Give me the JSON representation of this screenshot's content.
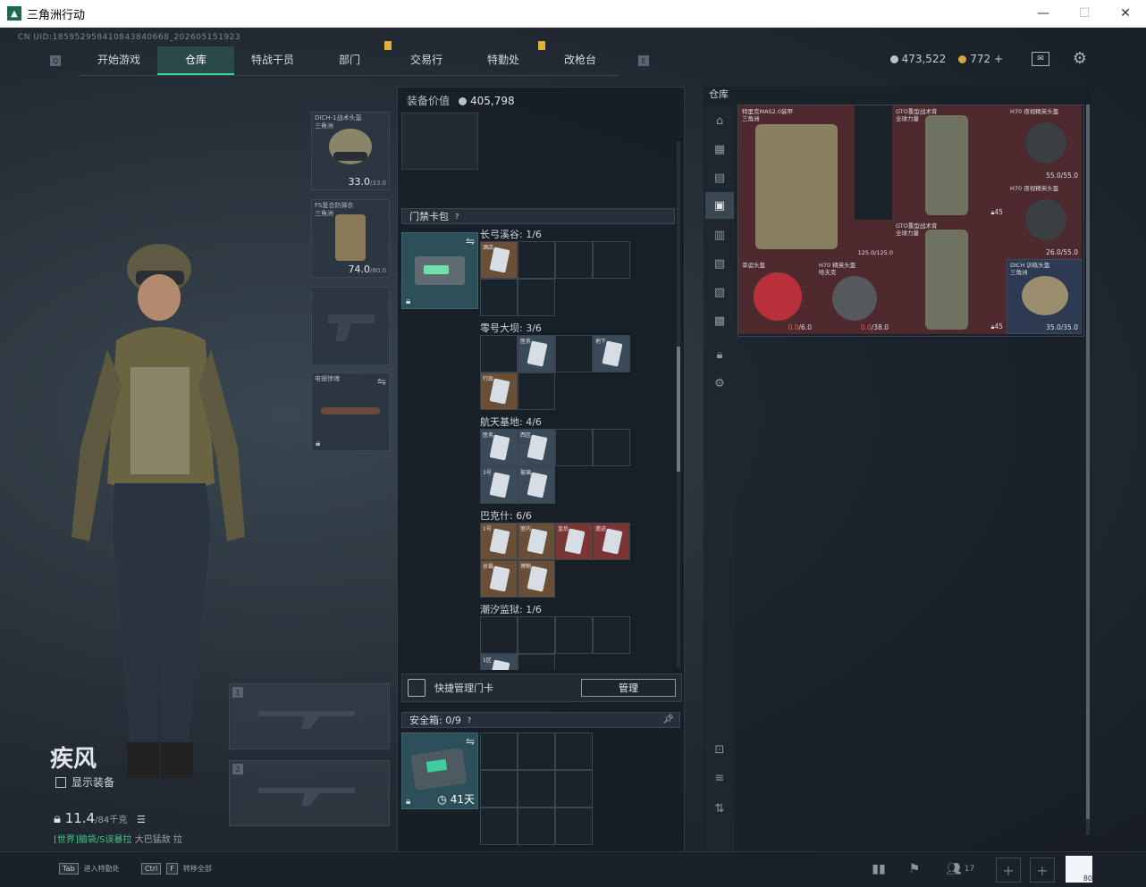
{
  "window": {
    "title": "三角洲行动",
    "minimize": "—",
    "maximize": "☐",
    "close": "✕"
  },
  "uid": "CN UID:1859529584108438406​68_202605151923",
  "nav": {
    "left_key": "Q",
    "right_key": "E",
    "tabs": [
      {
        "label": "开始游戏",
        "active": false,
        "badge": false
      },
      {
        "label": "仓库",
        "active": true,
        "badge": false
      },
      {
        "label": "特战干员",
        "active": false,
        "badge": false
      },
      {
        "label": "部门",
        "active": false,
        "badge": true
      },
      {
        "label": "交易行",
        "active": false,
        "badge": false
      },
      {
        "label": "特勤处",
        "active": false,
        "badge": true
      },
      {
        "label": "改枪台",
        "active": false,
        "badge": false
      }
    ]
  },
  "currency": {
    "silver": "473,522",
    "gold": "772",
    "gold_plus": "+"
  },
  "character": {
    "name": "疾风",
    "show_equipment": "显示装备",
    "weight": "11.4",
    "weight_max": "/84千克",
    "status_green": "[世界]脑袋/S误暴拉",
    "status_rest": " 大巴猛敌 拉"
  },
  "gear": {
    "helmet": {
      "label1": "DICH-1战术头盔",
      "label2": "三角洲",
      "dur": "33.0",
      "dur_max": "/33.0"
    },
    "armor": {
      "label1": "FS复合防弹衣",
      "label2": "三角洲",
      "dur": "74.0",
      "dur_max": "/80.0"
    },
    "melee": {
      "label1": "电锯惊魂"
    },
    "weapon1": "1",
    "weapon2": "2"
  },
  "mid": {
    "equip_value_label": "装备价值",
    "equip_value": "405,798",
    "keybag_label": "门禁卡包",
    "keybag_help": "?",
    "groups": [
      {
        "title": "长弓溪谷: 1/6",
        "card_labels": [
          "酒店"
        ]
      },
      {
        "title": "零号大坝: 3/6",
        "card_labels": [
          "医务",
          "地下",
          "行政"
        ]
      },
      {
        "title": "航天基地: 4/6",
        "card_labels": [
          "医务",
          "西区",
          "3号",
          "玻璃"
        ]
      },
      {
        "title": "巴克什: 6/6",
        "card_labels": [
          "1号",
          "室内",
          "皇后",
          "遗迹",
          "总裁",
          "博物"
        ]
      },
      {
        "title": "潮汐监狱: 1/6",
        "card_labels": [
          "1区"
        ]
      }
    ],
    "quick_manage": "快捷管理门卡",
    "manage_btn": "管理",
    "safe_label": "安全箱:",
    "safe_count": "0/9",
    "safe_help": "?",
    "safe_days": "41天"
  },
  "right": {
    "title": "仓库",
    "items": [
      {
        "name1": "特里克MAS2.0装甲",
        "name2": "三角洲",
        "dur": ""
      },
      {
        "name1": "GTO重型战术背",
        "name2": "全球力量",
        "dur": "45"
      },
      {
        "name1": "H70 夜视精英头盔",
        "name2": "",
        "dur": "55.0/55.0"
      },
      {
        "name1": "H70 夜视精英头盔",
        "name2": "",
        "dur": "26.0/55.0"
      },
      {
        "name1": "GTO重型战术背",
        "name2": "全球力量",
        "dur": "45"
      },
      {
        "name1": "",
        "name2": "",
        "dur": "125.0/125.0"
      },
      {
        "name1": "幸运头盔",
        "name2": "",
        "dur_red": "0.0",
        "dur_rest": "/6.0"
      },
      {
        "name1": "H70 精英头盔",
        "name2": "哈夫克",
        "dur_red": "0.0",
        "dur_rest": "/38.0"
      },
      {
        "name1": "DICH 训练头盔",
        "name2": "三角洲",
        "dur": "35.0/35.0"
      }
    ]
  },
  "bottom": {
    "hint1_key": "Tab",
    "hint1": "进入特勤处",
    "hint2_key1": "Ctrl",
    "hint2_key2": "F",
    "hint2": "转移全部",
    "friends": "17",
    "avatar_num": "80"
  },
  "colors": {
    "accent": "#39d39a",
    "badge": "#e0b03a",
    "stash_red": "#4e2a2e",
    "stash_blue": "#2d3a52"
  }
}
